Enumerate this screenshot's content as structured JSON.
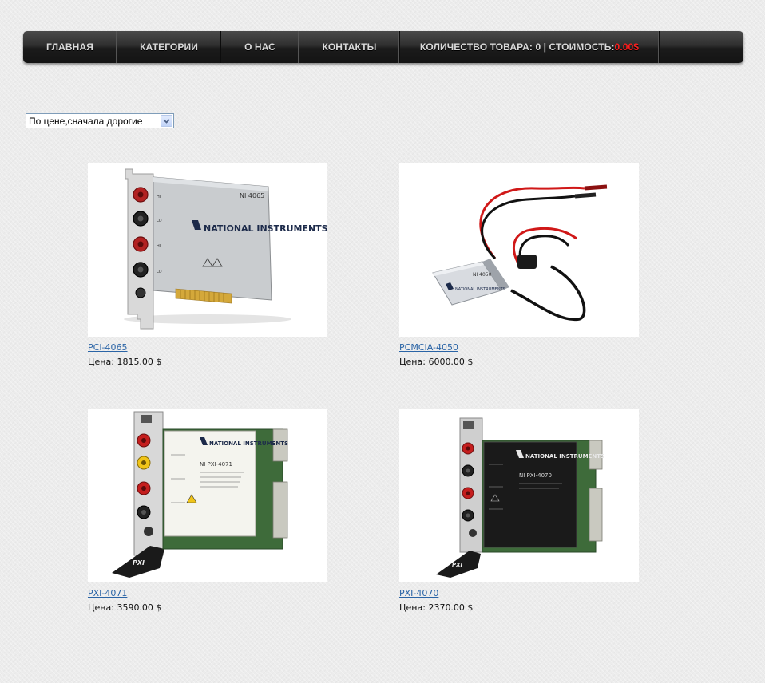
{
  "nav": {
    "home": "ГЛАВНАЯ",
    "categories": "КАТЕГОРИИ",
    "about": "О НАС",
    "contacts": "КОНТАКТЫ",
    "cart_label": "КОЛИЧЕСТВО ТОВАРА: 0 | СТОИМОСТЬ: ",
    "cart_price": "0.00$"
  },
  "sort": {
    "selected": "По цене,сначала дорогие"
  },
  "products": [
    {
      "name": "PCI-4065",
      "price_label": "Цена: 1815.00 $",
      "brand_text": "NATIONAL INSTRUMENTS",
      "model_text": "NI 4065"
    },
    {
      "name": "PCMCIA-4050",
      "price_label": "Цена: 6000.00 $",
      "brand_text": "NATIONAL INSTRUMENTS",
      "model_text": "NI 4050"
    },
    {
      "name": "PXI-4071",
      "price_label": "Цена: 3590.00 $",
      "brand_text": "NATIONAL INSTRUMENTS",
      "model_text": "NI PXI-4071"
    },
    {
      "name": "PXI-4070",
      "price_label": "Цена: 2370.00 $",
      "brand_text": "NATIONAL INSTRUMENTS",
      "model_text": "NI PXI-4070"
    }
  ],
  "colors": {
    "nav_bg": "#1b1b1b",
    "nav_text": "#d9d9d9",
    "cart_price": "#ff1e1e",
    "link": "#2a64a6",
    "page_bg": "#ececec"
  }
}
